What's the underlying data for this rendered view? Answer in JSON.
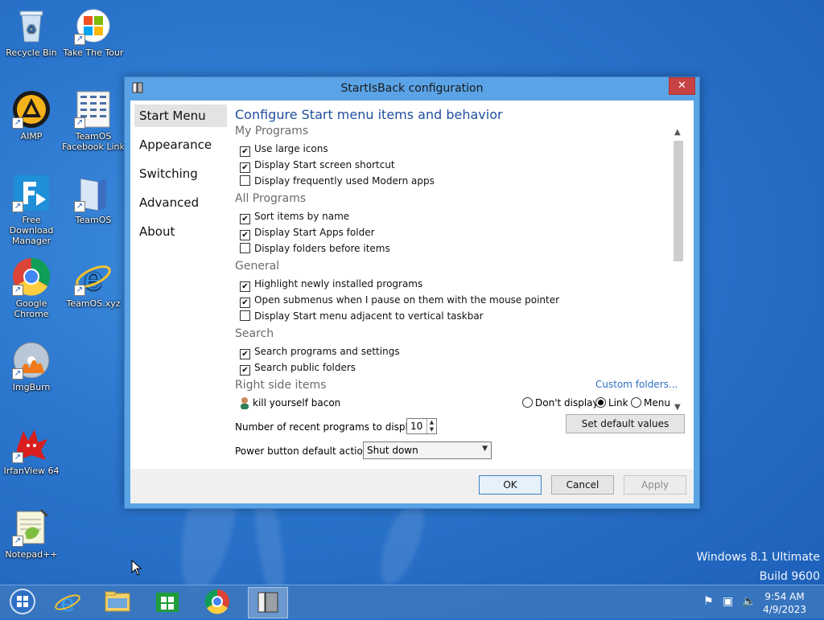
{
  "desktop": {
    "icons": [
      {
        "label": "Recycle Bin"
      },
      {
        "label": "Take The Tour"
      },
      {
        "label": "AIMP"
      },
      {
        "label": "TeamOS Facebook Link"
      },
      {
        "label": "Free Download Manager"
      },
      {
        "label": "TeamOS"
      },
      {
        "label": "Google Chrome"
      },
      {
        "label": "TeamOS.xyz"
      },
      {
        "label": "ImgBurn"
      },
      {
        "label": "IrfanView 64"
      },
      {
        "label": "Notepad++"
      }
    ],
    "watermark_line1": "Windows 8.1 Ultimate",
    "watermark_line2": "Build 9600"
  },
  "window": {
    "title": "StartIsBack configuration",
    "close_glyph": "✕",
    "nav": [
      {
        "label": "Start Menu"
      },
      {
        "label": "Appearance"
      },
      {
        "label": "Switching"
      },
      {
        "label": "Advanced"
      },
      {
        "label": "About"
      }
    ],
    "heading": "Configure Start menu items and behavior",
    "sections": {
      "my_programs": "My Programs",
      "all_programs": "All Programs",
      "general": "General",
      "search": "Search",
      "right_side": "Right side items"
    },
    "options": {
      "large_icons": "Use large icons",
      "start_screen_shortcut": "Display Start screen shortcut",
      "modern_apps": "Display frequently used Modern apps",
      "sort_by_name": "Sort items by name",
      "start_apps_folder": "Display Start Apps folder",
      "folders_before": "Display folders before items",
      "highlight_new": "Highlight newly installed programs",
      "open_submenus": "Open submenus when I pause on them with the mouse pointer",
      "adjacent_taskbar": "Display Start menu adjacent to vertical taskbar",
      "search_programs": "Search programs and settings",
      "search_public": "Search public folders"
    },
    "custom_folders_link": "Custom folders...",
    "right_item": {
      "name": "kill yourself bacon",
      "radio_dont": "Don't display",
      "radio_link": "Link",
      "radio_menu": "Menu"
    },
    "recent_label": "Number of recent programs to display:",
    "recent_value": "10",
    "set_default": "Set default values",
    "power_label": "Power button default action:",
    "power_value": "Shut down",
    "ok": "OK",
    "cancel": "Cancel",
    "apply": "Apply",
    "check_glyph": "✔"
  },
  "taskbar": {
    "time": "9:54 AM",
    "date": "4/9/2023"
  }
}
